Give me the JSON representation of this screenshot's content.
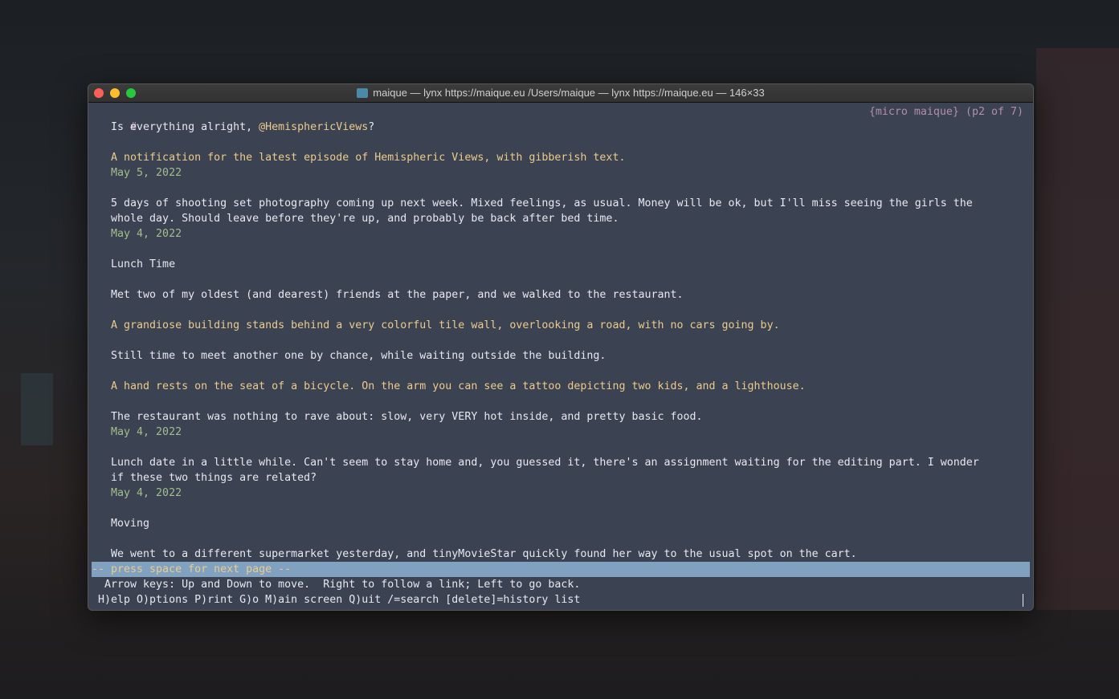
{
  "window": {
    "title": "maique — lynx https://maique.eu /Users/maique — lynx https://maique.eu — 146×33"
  },
  "header": {
    "hash": "#",
    "page_info": "{micro maique} (p2 of 7)"
  },
  "lines": [
    {
      "row": 1,
      "segs": [
        {
          "t": "   Is everything alright, ",
          "c": ""
        },
        {
          "t": "@HemisphericViews",
          "c": "y",
          "link": true
        },
        {
          "t": "?",
          "c": ""
        }
      ]
    },
    {
      "row": 3,
      "segs": [
        {
          "t": "   A notification for the latest episode of Hemispheric Views, with gibberish text.",
          "c": "y"
        }
      ]
    },
    {
      "row": 4,
      "segs": [
        {
          "t": "   May 5, 2022",
          "c": "g",
          "link": true
        }
      ]
    },
    {
      "row": 6,
      "segs": [
        {
          "t": "   5 days of shooting set photography coming up next week. Mixed feelings, as usual. Money will be ok, but I'll miss seeing the girls the",
          "c": ""
        }
      ]
    },
    {
      "row": 7,
      "segs": [
        {
          "t": "   whole day. Should leave before they're up, and probably be back after bed time.",
          "c": ""
        }
      ]
    },
    {
      "row": 8,
      "segs": [
        {
          "t": "   May 4, 2022",
          "c": "g",
          "link": true
        }
      ]
    },
    {
      "row": 10,
      "segs": [
        {
          "t": "   Lunch Time",
          "c": ""
        }
      ]
    },
    {
      "row": 12,
      "segs": [
        {
          "t": "   Met two of my oldest (and dearest) friends at the paper, and we walked to the restaurant.",
          "c": ""
        }
      ]
    },
    {
      "row": 14,
      "segs": [
        {
          "t": "   A grandiose building stands behind a very colorful tile wall, overlooking a road, with no cars going by.",
          "c": "y"
        }
      ]
    },
    {
      "row": 16,
      "segs": [
        {
          "t": "   Still time to meet another one by chance, while waiting outside the building.",
          "c": ""
        }
      ]
    },
    {
      "row": 18,
      "segs": [
        {
          "t": "   A hand rests on the seat of a bicycle. On the arm you can see a tattoo depicting two kids, and a lighthouse.",
          "c": "y"
        }
      ]
    },
    {
      "row": 20,
      "segs": [
        {
          "t": "   The restaurant was nothing to rave about: slow, very VERY hot inside, and pretty basic food.",
          "c": ""
        }
      ]
    },
    {
      "row": 21,
      "segs": [
        {
          "t": "   May 4, 2022",
          "c": "g",
          "link": true
        }
      ]
    },
    {
      "row": 23,
      "segs": [
        {
          "t": "   Lunch date in a little while. Can't seem to stay home and, you guessed it, there's an assignment waiting for the editing part. I wonder",
          "c": ""
        }
      ]
    },
    {
      "row": 24,
      "segs": [
        {
          "t": "   if these two things are related?",
          "c": ""
        }
      ]
    },
    {
      "row": 25,
      "segs": [
        {
          "t": "   May 4, 2022",
          "c": "g",
          "link": true
        }
      ]
    },
    {
      "row": 27,
      "segs": [
        {
          "t": "   Moving",
          "c": ""
        }
      ]
    },
    {
      "row": 29,
      "segs": [
        {
          "t": "   We went to a different supermarket yesterday, and tinyMovieStar quickly found her way to the usual spot on the cart.",
          "c": ""
        }
      ]
    }
  ],
  "status": {
    "prompt": "-- press space for next page --",
    "help1": "  Arrow keys: Up and Down to move.  Right to follow a link; Left to go back.",
    "help2": " H)elp O)ptions P)rint G)o M)ain screen Q)uit /=search [delete]=history list"
  },
  "colors": {
    "bg": "#3b4252",
    "text": "#e5e9f0",
    "link": "#ebcb8b",
    "date": "#a3be8c",
    "status_bar": "#81a1c1"
  }
}
